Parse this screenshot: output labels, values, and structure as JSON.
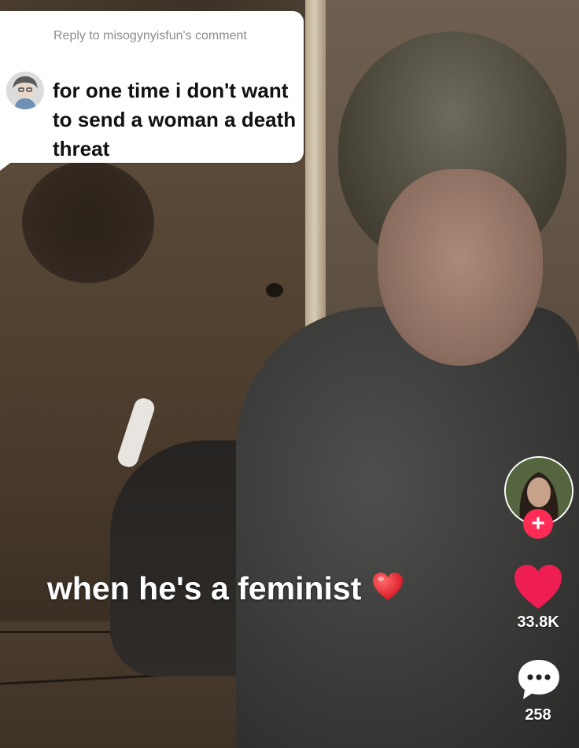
{
  "reply": {
    "meta": "Reply to misogynyisfun's comment",
    "text": "for one time i don't want to send a woman a death threat"
  },
  "caption": {
    "text": "when he's a feminist",
    "emoji": "red-heart-emoji"
  },
  "actions": {
    "follow_label": "+",
    "like_count": "33.8K",
    "comment_count": "258"
  },
  "colors": {
    "tiktok_red": "#fe2c55",
    "heart_red": "#ee1d52",
    "bubble_bg": "#ffffff",
    "meta_gray": "#8c8c8c"
  },
  "icons": {
    "like": "heart-icon",
    "comment": "comment-bubble-icon",
    "follow": "plus-icon"
  }
}
